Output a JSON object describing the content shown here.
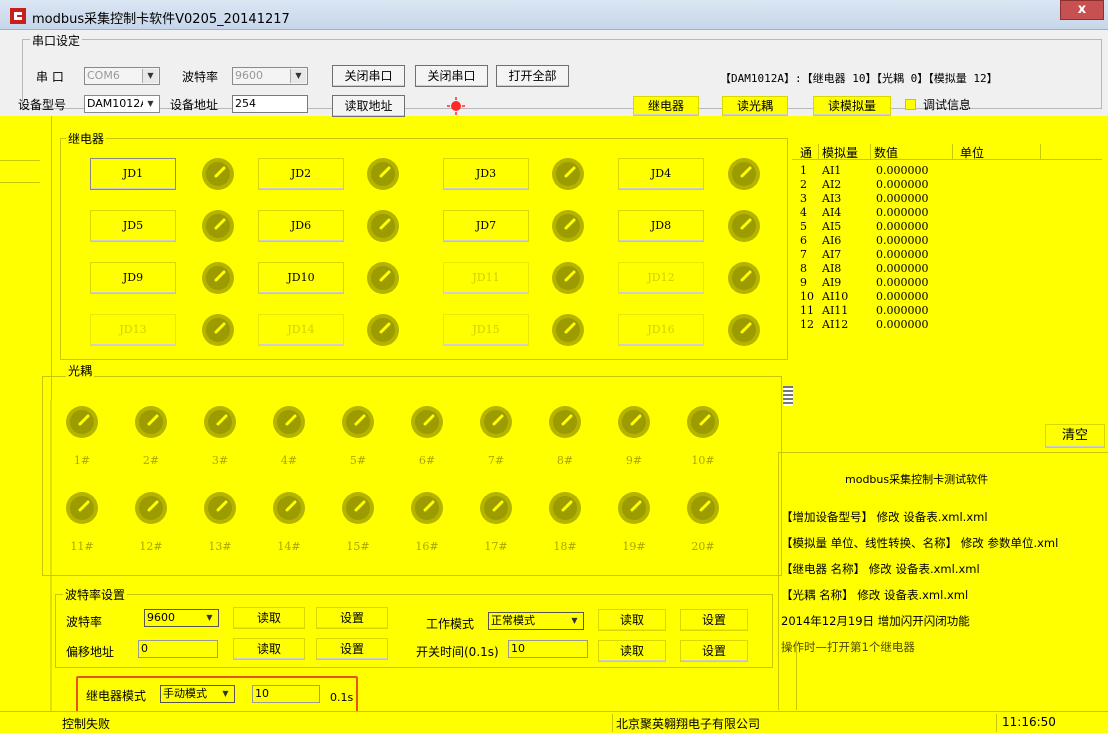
{
  "window": {
    "title": "modbus采集控制卡软件V0205_20141217",
    "close_glyph": "x"
  },
  "serial": {
    "legend": "串口设定",
    "port_label": "串 口",
    "port_value": "COM6",
    "baud_label": "波特率",
    "baud_value": "9600",
    "close_port_1": "关闭串口",
    "close_port_2": "关闭串口",
    "open_all": "打开全部",
    "device_info": "【DAM1012A】:【继电器  10】【光耦 0】【模拟量 12】",
    "model_label": "设备型号",
    "model_value": "DAM1012A",
    "addr_label": "设备地址",
    "addr_value": "254",
    "read_addr": "读取地址",
    "read_relay": "继电器",
    "read_opto": "读光耦",
    "read_analog": "读模拟量",
    "debug_label": "调试信息"
  },
  "relay": {
    "legend": "继电器",
    "buttons": [
      "JD1",
      "JD2",
      "JD3",
      "JD4",
      "JD5",
      "JD6",
      "JD7",
      "JD8",
      "JD9",
      "JD10",
      "JD11",
      "JD12",
      "JD13",
      "JD14",
      "JD15",
      "JD16"
    ]
  },
  "analog": {
    "headers": {
      "ch": "通",
      "name": "模拟量",
      "value": "数值",
      "unit": "单位"
    },
    "rows": [
      {
        "ch": "1",
        "name": "AI1",
        "value": "0.000000"
      },
      {
        "ch": "2",
        "name": "AI2",
        "value": "0.000000"
      },
      {
        "ch": "3",
        "name": "AI3",
        "value": "0.000000"
      },
      {
        "ch": "4",
        "name": "AI4",
        "value": "0.000000"
      },
      {
        "ch": "5",
        "name": "AI5",
        "value": "0.000000"
      },
      {
        "ch": "6",
        "name": "AI6",
        "value": "0.000000"
      },
      {
        "ch": "7",
        "name": "AI7",
        "value": "0.000000"
      },
      {
        "ch": "8",
        "name": "AI8",
        "value": "0.000000"
      },
      {
        "ch": "9",
        "name": "AI9",
        "value": "0.000000"
      },
      {
        "ch": "10",
        "name": "AI10",
        "value": "0.000000"
      },
      {
        "ch": "11",
        "name": "AI11",
        "value": "0.000000"
      },
      {
        "ch": "12",
        "name": "AI12",
        "value": "0.000000"
      }
    ]
  },
  "opto": {
    "legend": "光耦",
    "labels": [
      "1#",
      "2#",
      "3#",
      "4#",
      "5#",
      "6#",
      "7#",
      "8#",
      "9#",
      "10#",
      "11#",
      "12#",
      "13#",
      "14#",
      "15#",
      "16#",
      "17#",
      "18#",
      "19#",
      "20#"
    ]
  },
  "log": {
    "clear": "清空",
    "lines": [
      "modbus采集控制卡测试软件",
      "【增加设备型号】 修改  设备表.xml.xml",
      "【模拟量 单位、线性转换、名称】 修改 参数单位.xml",
      "【继电器 名称】 修改  设备表.xml.xml",
      "【光耦 名称】 修改  设备表.xml.xml",
      "2014年12月19日   增加闪开闪闭功能",
      "操作时—打开第1个继电器"
    ]
  },
  "settings": {
    "legend": "波特率设置",
    "baud_label": "波特率",
    "baud_value": "9600",
    "read": "读取",
    "set": "设置",
    "offset_label": "偏移地址",
    "offset_value": "0",
    "mode_label": "工作模式",
    "mode_value": "正常模式",
    "switch_time_label": "开关时间(0.1s)",
    "switch_time_value": "10",
    "relay_mode_label": "继电器模式",
    "relay_mode_value": "手动模式",
    "relay_time_value": "10",
    "relay_time_unit": "0.1s"
  },
  "status": {
    "left": "控制失败",
    "company": "北京聚英翱翔电子有限公司",
    "time": "11:16:50"
  },
  "colors": {
    "bg": "#ffff00",
    "knob": "#b4b400",
    "highlight": "#e8541e"
  }
}
